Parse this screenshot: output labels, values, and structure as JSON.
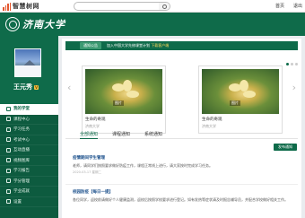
{
  "topbar": {
    "logo_text": "智慧树网",
    "search_placeholder": "搜索课程名称、开课学校、老师等",
    "links": [
      "首页",
      "退出"
    ]
  },
  "banner": {
    "brand": "济南大学"
  },
  "sidebar": {
    "user_name": "王元秀",
    "user_tag": "Ⅴ",
    "nav_items": [
      "我的学堂",
      "课程中心",
      "学习任务",
      "考试中心",
      "互动直播",
      "视频图库",
      "学习报告",
      "学分管理",
      "学业成就",
      "设置"
    ],
    "active_index": 0
  },
  "main": {
    "notice": {
      "tag": "通知公告",
      "text": "加入中国大学先修课堂计划",
      "link": "下载客户端"
    },
    "courses": [
      {
        "badge": "图片",
        "title": "生命的奇观",
        "meta": "济南大学"
      },
      {
        "badge": "图片",
        "title": "生命的奇观",
        "meta": "济南大学"
      }
    ],
    "tabs": [
      "全部通知",
      "课程通知",
      "系统通知"
    ],
    "active_tab": 0,
    "publish_label": "发布通知",
    "notices": [
      {
        "title": "疫情期间学生管理",
        "body": "老师，请同学们按照要求做好防疫工作，课程正常线上进行，请大家按时完成学习任务。",
        "time": "2020-03-17 星期二"
      },
      {
        "title": "校园防疫【每日一提】",
        "body": "各位同学，返校前请做好个人健康监测，返校后按照学校要求进行登记。如有发热等症状请及时报告辅导员，并配合学校做好相关工作。",
        "time": "2020-03-16 星期一"
      }
    ]
  },
  "colors": {
    "brand_green": "#0f6b4a",
    "sidebar_green": "#0d5b3f",
    "accent_orange": "#e4562e"
  }
}
